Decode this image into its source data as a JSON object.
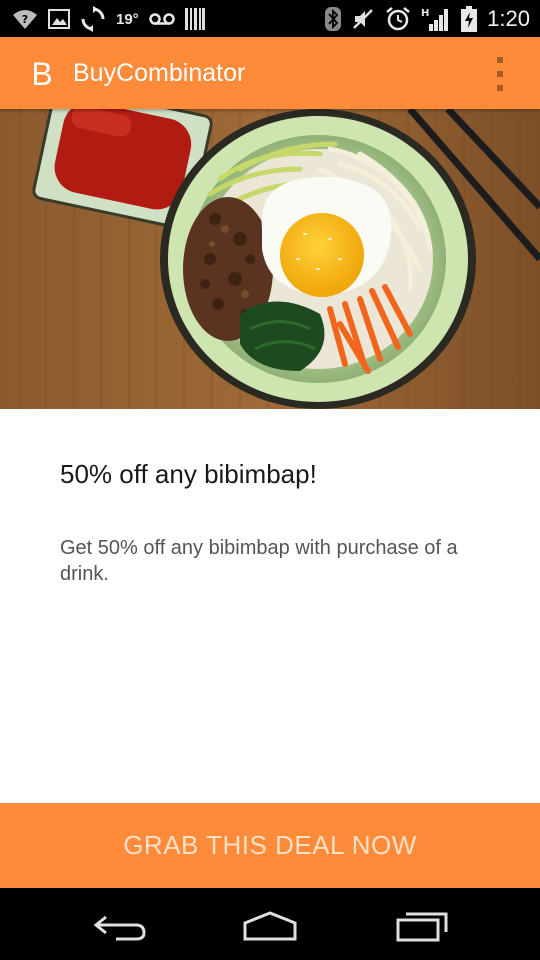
{
  "status_bar": {
    "temperature": "19°",
    "clock": "1:20",
    "icons": [
      "wifi-question-icon",
      "image-icon",
      "sync-icon",
      "voicemail-icon",
      "barcode-icon",
      "bluetooth-icon",
      "mute-icon",
      "alarm-icon",
      "signal-h-icon",
      "battery-charging-icon"
    ]
  },
  "app_bar": {
    "logo_letter": "B",
    "title": "BuyCombinator",
    "overflow_icon": "more-vert-icon"
  },
  "hero": {
    "image_alt": "bibimbap-photo"
  },
  "deal": {
    "title": "50% off any bibimbap!",
    "description": "Get 50% off any bibimbap with purchase of a drink."
  },
  "cta": {
    "label": "GRAB THIS DEAL NOW"
  },
  "nav_bar": {
    "icons": [
      "back-icon",
      "home-icon",
      "recent-apps-icon"
    ]
  },
  "colors": {
    "accent": "#fd8b3a",
    "cta_text": "#fde0c8",
    "title_text": "#1a1a1a",
    "body_text": "#555555"
  }
}
